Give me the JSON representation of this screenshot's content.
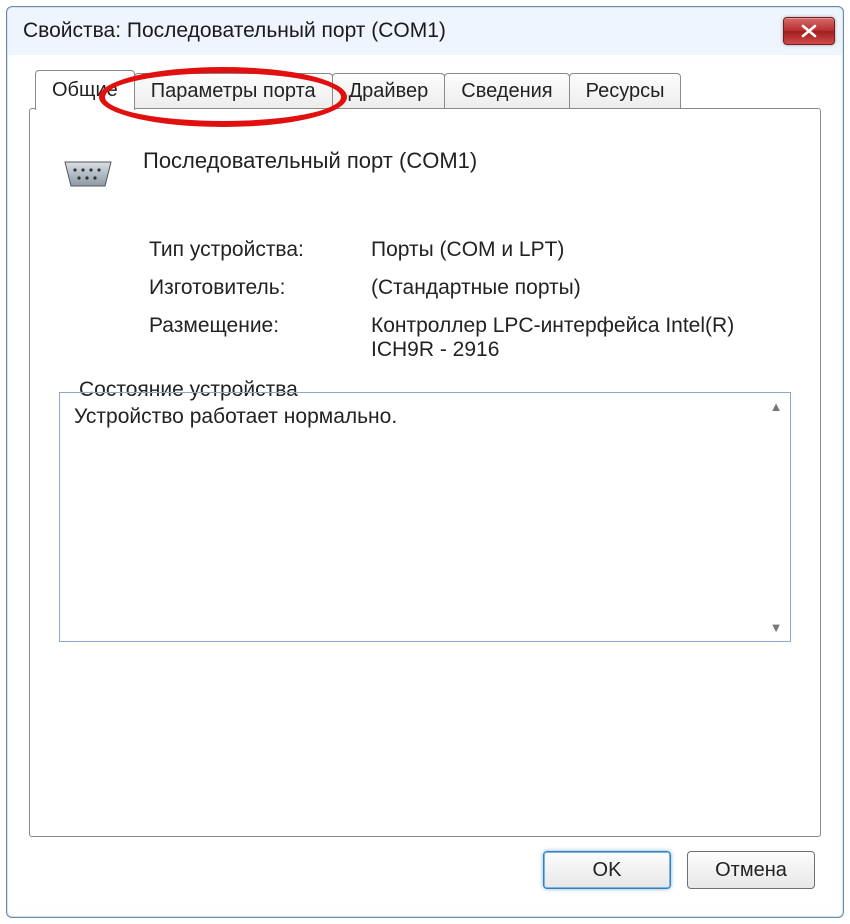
{
  "window": {
    "title": "Свойства: Последовательный порт (COM1)"
  },
  "tabs": [
    {
      "label": "Общие",
      "active": true
    },
    {
      "label": "Параметры порта",
      "active": false,
      "highlighted": true
    },
    {
      "label": "Драйвер",
      "active": false
    },
    {
      "label": "Сведения",
      "active": false
    },
    {
      "label": "Ресурсы",
      "active": false
    }
  ],
  "device": {
    "name": "Последовательный порт (COM1)",
    "icon": "serial-port-icon"
  },
  "info": {
    "type_label": "Тип устройства:",
    "type_value": "Порты (COM и LPT)",
    "manufacturer_label": "Изготовитель:",
    "manufacturer_value": "(Стандартные порты)",
    "location_label": "Размещение:",
    "location_value": "Контроллер LPC-интерфейса Intel(R) ICH9R - 2916"
  },
  "status": {
    "legend": "Состояние устройства",
    "text": "Устройство работает нормально."
  },
  "buttons": {
    "ok": "OK",
    "cancel": "Отмена"
  }
}
